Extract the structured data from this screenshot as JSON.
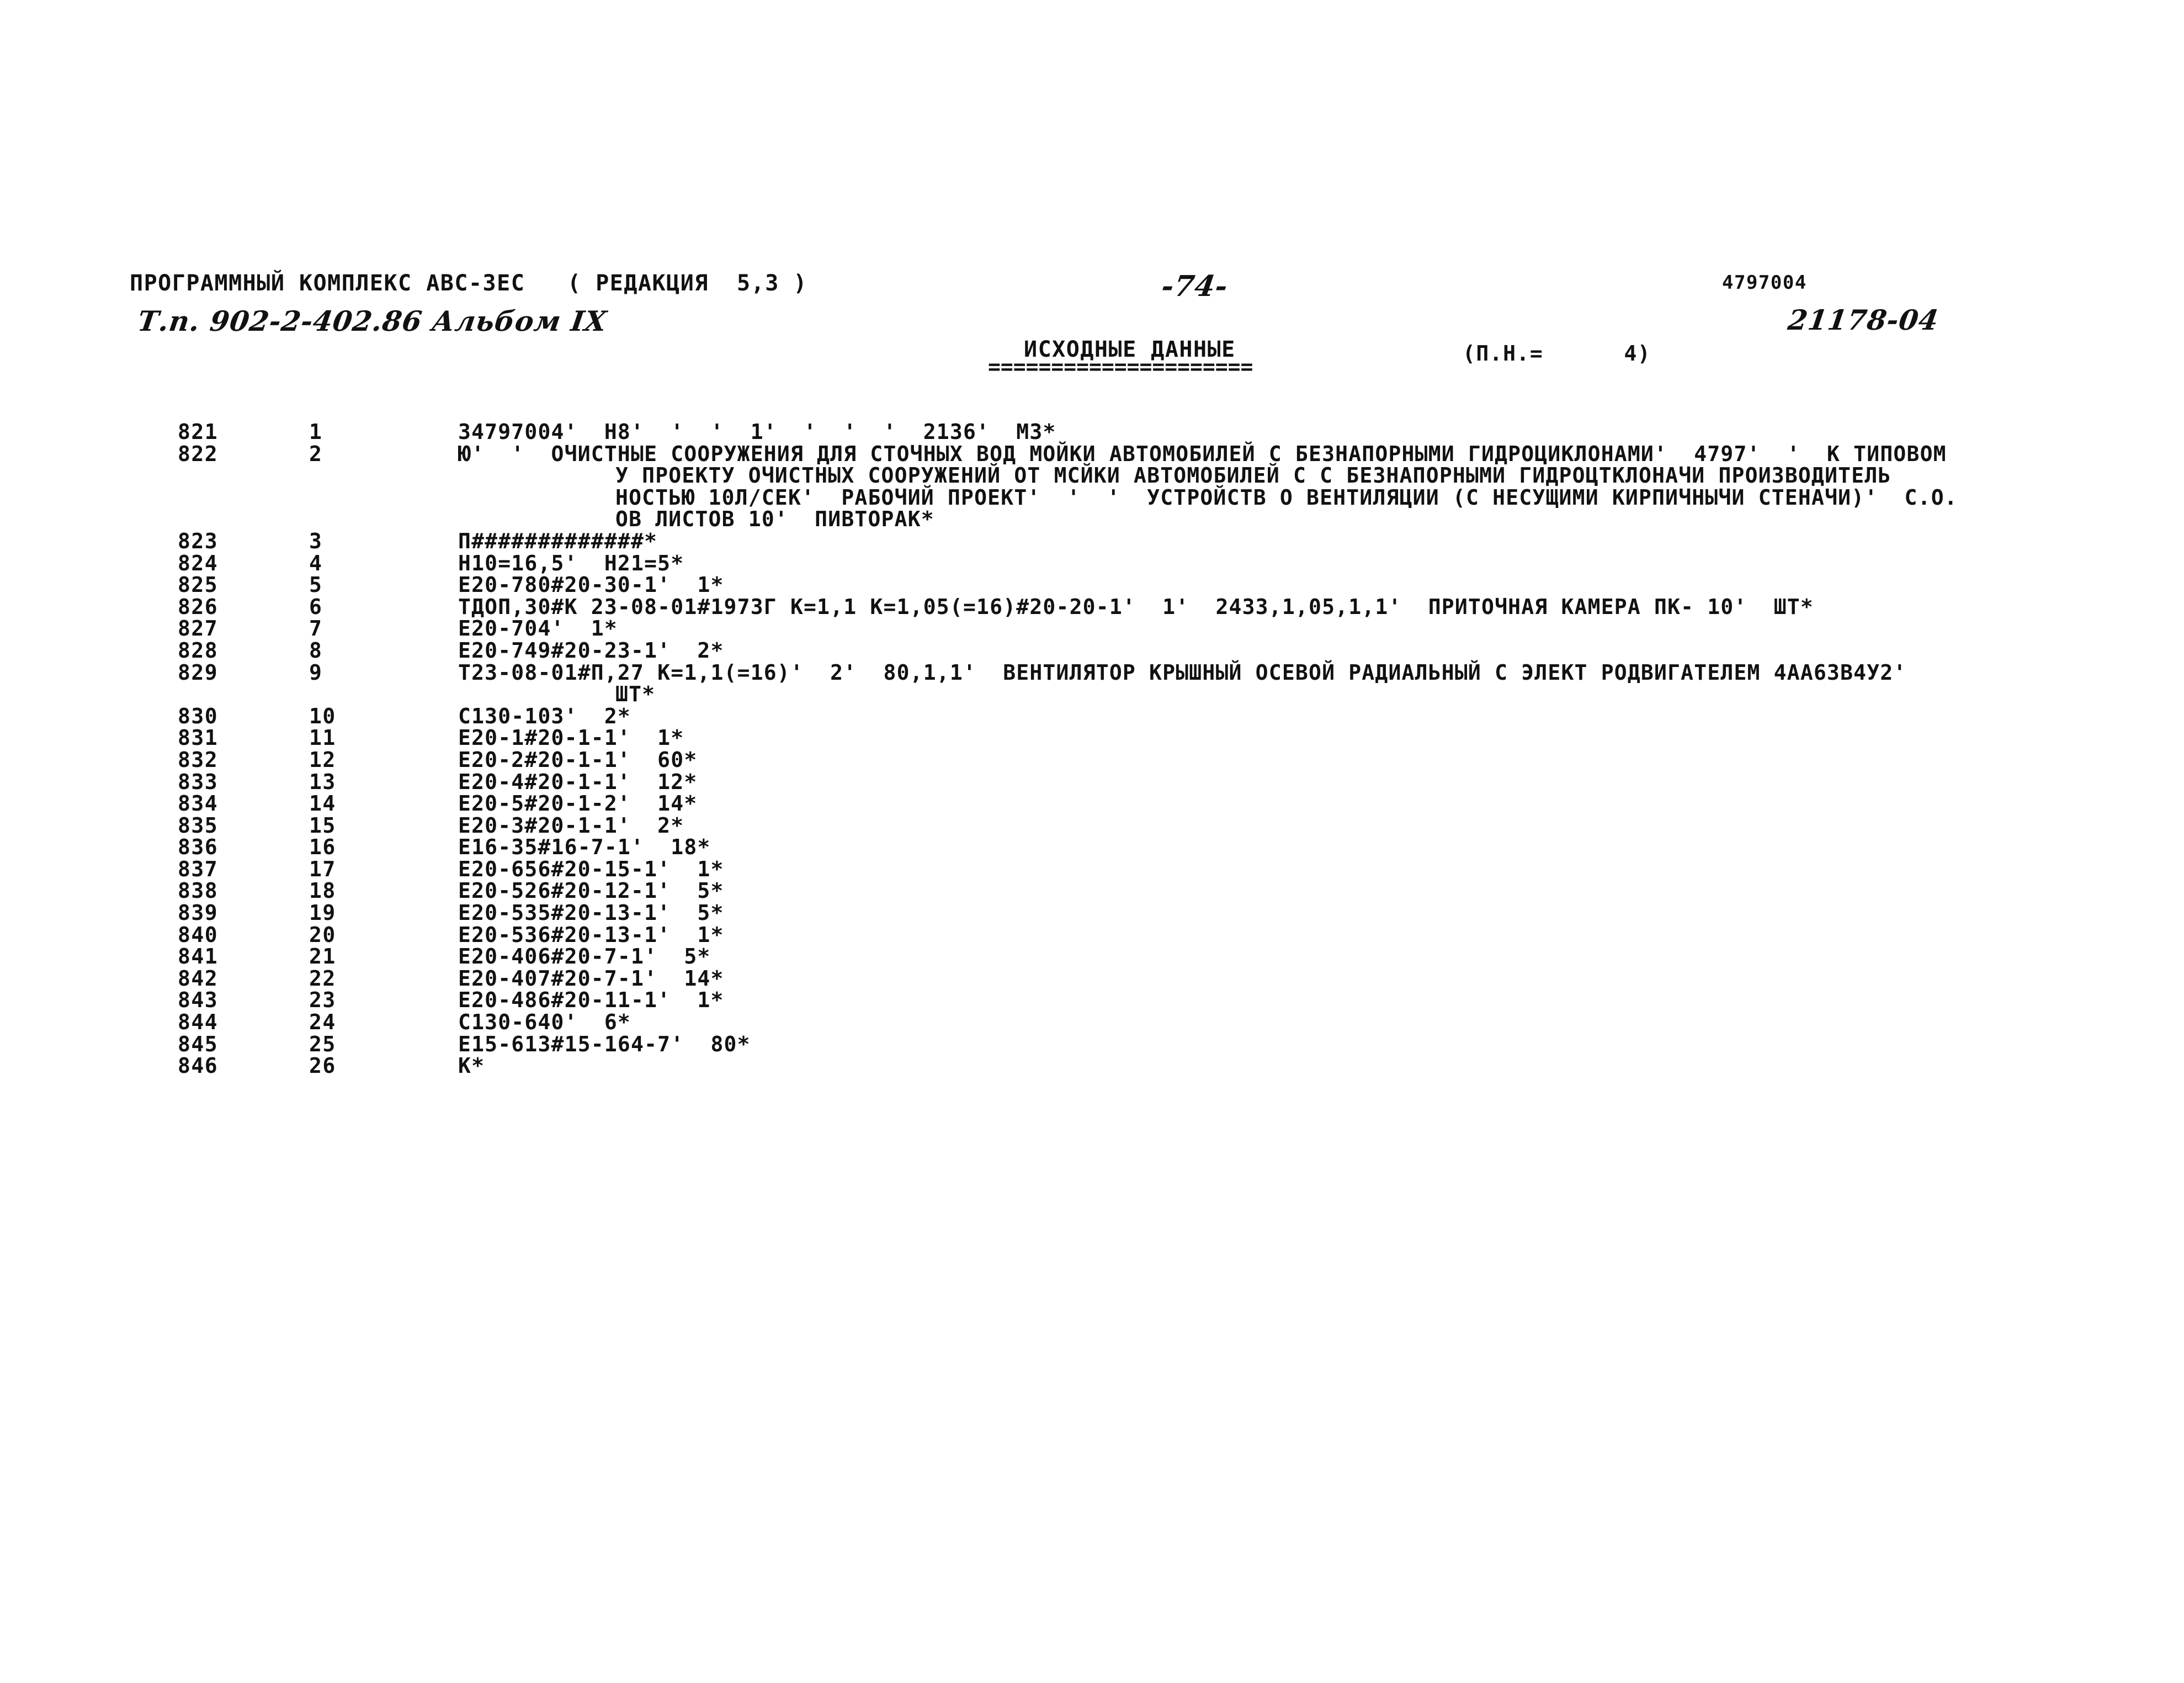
{
  "header": {
    "program_title": "ПРОГРАММНЫЙ КОМПЛЕКС АВС-3ЕС   ( РЕДАКЦИЯ  5,3 )",
    "album_reference": "Т.п. 902-2-402.86 Альбом IX",
    "page_number": "-74-",
    "doc_code": "4797004",
    "drawing_number": "21178-04",
    "section_title": "ИСХОДНЫЕ ДАННЫЕ",
    "section_rule": "=====================",
    "pn_label": "(П.Н.=      4)"
  },
  "listing": {
    "rows": [
      {
        "line": "821",
        "seq": "1",
        "text": "34797004'  Н8'  '  '  1'  '  '  '  2136'  М3*",
        "indent": 0
      },
      {
        "line": "822",
        "seq": "2",
        "text": "Ю'  '  ОЧИСТНЫЕ СООРУЖЕНИЯ ДЛЯ СТОЧНЫХ ВОД МОЙКИ АВТОМОБИЛЕЙ С БЕЗНАПОРНЫМИ ГИДРОЦИКЛОНАМИ'  4797'  '  К ТИПОВОМ",
        "indent": 0
      },
      {
        "line": "",
        "seq": "",
        "text": "У ПРОЕКТУ ОЧИСТНЫХ СООРУЖЕНИЙ ОТ МСЙКИ АВТОМОБИЛЕЙ С С БЕЗНАПОРНЫМИ ГИДРОЦТКЛОНАЧИ ПРОИЗВОДИТЕЛЬ",
        "indent": 1
      },
      {
        "line": "",
        "seq": "",
        "text": "НОСТЬЮ 10Л/СЕК'  РАБОЧИЙ ПРОЕКТ'  '  '  УСТРОЙСТВ О ВЕНТИЛЯЦИИ (С НЕСУЩИМИ КИРПИЧНЫЧИ СТЕНАЧИ)'  С.О.",
        "indent": 1
      },
      {
        "line": "",
        "seq": "",
        "text": "ОВ ЛИСТОВ 10'  ПИВТОРАК*",
        "indent": 1
      },
      {
        "line": "823",
        "seq": "3",
        "text": "П#############*",
        "indent": 0
      },
      {
        "line": "824",
        "seq": "4",
        "text": "Н10=16,5'  Н21=5*",
        "indent": 0
      },
      {
        "line": "825",
        "seq": "5",
        "text": "Е20-780#20-30-1'  1*",
        "indent": 0
      },
      {
        "line": "826",
        "seq": "6",
        "text": "ТДОП,30#К 23-08-01#1973Г К=1,1 К=1,05(=16)#20-20-1'  1'  2433,1,05,1,1'  ПРИТОЧНАЯ КАМЕРА ПК- 10'  ШТ*",
        "indent": 0
      },
      {
        "line": "827",
        "seq": "7",
        "text": "Е20-704'  1*",
        "indent": 0
      },
      {
        "line": "828",
        "seq": "8",
        "text": "Е20-749#20-23-1'  2*",
        "indent": 0
      },
      {
        "line": "829",
        "seq": "9",
        "text": "Т23-08-01#П,27 К=1,1(=16)'  2'  80,1,1'  ВЕНТИЛЯТОР КРЫШНЫЙ ОСЕВОЙ РАДИАЛЬНЫЙ С ЭЛЕКТ РОДВИГАТЕЛЕМ 4АА63В4У2'",
        "indent": 0
      },
      {
        "line": "",
        "seq": "",
        "text": "ШТ*",
        "indent": 1
      },
      {
        "line": "830",
        "seq": "10",
        "text": "С130-103'  2*",
        "indent": 0
      },
      {
        "line": "831",
        "seq": "11",
        "text": "Е20-1#20-1-1'  1*",
        "indent": 0
      },
      {
        "line": "832",
        "seq": "12",
        "text": "Е20-2#20-1-1'  60*",
        "indent": 0
      },
      {
        "line": "833",
        "seq": "13",
        "text": "Е20-4#20-1-1'  12*",
        "indent": 0
      },
      {
        "line": "834",
        "seq": "14",
        "text": "Е20-5#20-1-2'  14*",
        "indent": 0
      },
      {
        "line": "835",
        "seq": "15",
        "text": "Е20-3#20-1-1'  2*",
        "indent": 0
      },
      {
        "line": "836",
        "seq": "16",
        "text": "Е16-35#16-7-1'  18*",
        "indent": 0
      },
      {
        "line": "837",
        "seq": "17",
        "text": "Е20-656#20-15-1'  1*",
        "indent": 0
      },
      {
        "line": "838",
        "seq": "18",
        "text": "Е20-526#20-12-1'  5*",
        "indent": 0
      },
      {
        "line": "839",
        "seq": "19",
        "text": "Е20-535#20-13-1'  5*",
        "indent": 0
      },
      {
        "line": "840",
        "seq": "20",
        "text": "Е20-536#20-13-1'  1*",
        "indent": 0
      },
      {
        "line": "841",
        "seq": "21",
        "text": "Е20-406#20-7-1'  5*",
        "indent": 0
      },
      {
        "line": "842",
        "seq": "22",
        "text": "Е20-407#20-7-1'  14*",
        "indent": 0
      },
      {
        "line": "843",
        "seq": "23",
        "text": "Е20-486#20-11-1'  1*",
        "indent": 0
      },
      {
        "line": "844",
        "seq": "24",
        "text": "С130-640'  6*",
        "indent": 0
      },
      {
        "line": "845",
        "seq": "25",
        "text": "Е15-613#15-164-7'  80*",
        "indent": 0
      },
      {
        "line": "846",
        "seq": "26",
        "text": "К*",
        "indent": 0
      }
    ]
  }
}
